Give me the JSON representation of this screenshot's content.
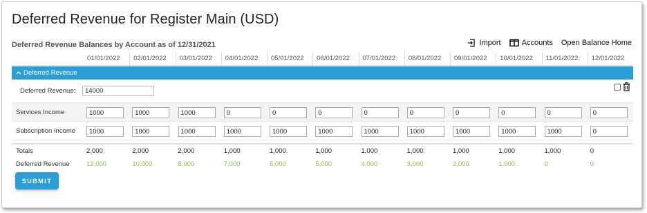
{
  "page": {
    "title": "Deferred Revenue for Register Main (USD)",
    "section_title": "Deferred Revenue Balances by Account as of 12/31/2021"
  },
  "toolbar": {
    "import_label": "Import",
    "accounts_label": "Accounts",
    "open_balance_label": "Open Balance Home"
  },
  "months": [
    "01/01/2022",
    "02/01/2022",
    "03/01/2022",
    "04/01/2022",
    "05/01/2022",
    "06/01/2022",
    "07/01/2022",
    "08/01/2022",
    "09/01/2022",
    "10/01/2022",
    "11/01/2022",
    "12/01/2022"
  ],
  "group": {
    "label": "Deferred Revenue",
    "field_label": "Deferred Revenue:",
    "field_value": "14000"
  },
  "rows": [
    {
      "label": "Services Income",
      "values": [
        "1000",
        "1000",
        "1000",
        "0",
        "0",
        "0",
        "0",
        "0",
        "0",
        "0",
        "0",
        "0"
      ]
    },
    {
      "label": "Subscription Income",
      "values": [
        "1000",
        "1000",
        "1000",
        "1000",
        "1000",
        "1000",
        "1000",
        "1000",
        "1000",
        "1000",
        "1000",
        "0"
      ]
    }
  ],
  "totals": {
    "label": "Totals",
    "values": [
      "2,000",
      "2,000",
      "2,000",
      "1,000",
      "1,000",
      "1,000",
      "1,000",
      "1,000",
      "1,000",
      "1,000",
      "1,000",
      "0"
    ]
  },
  "deferred": {
    "label": "Deferred Revenue",
    "values": [
      "12,000",
      "10,000",
      "8,000",
      "7,000",
      "6,000",
      "5,000",
      "4,000",
      "3,000",
      "2,000",
      "1,000",
      "0",
      "0"
    ]
  },
  "submit_label": "SUBMIT",
  "colors": {
    "accent": "#2a9ed6",
    "positive": "#8ac24a"
  }
}
